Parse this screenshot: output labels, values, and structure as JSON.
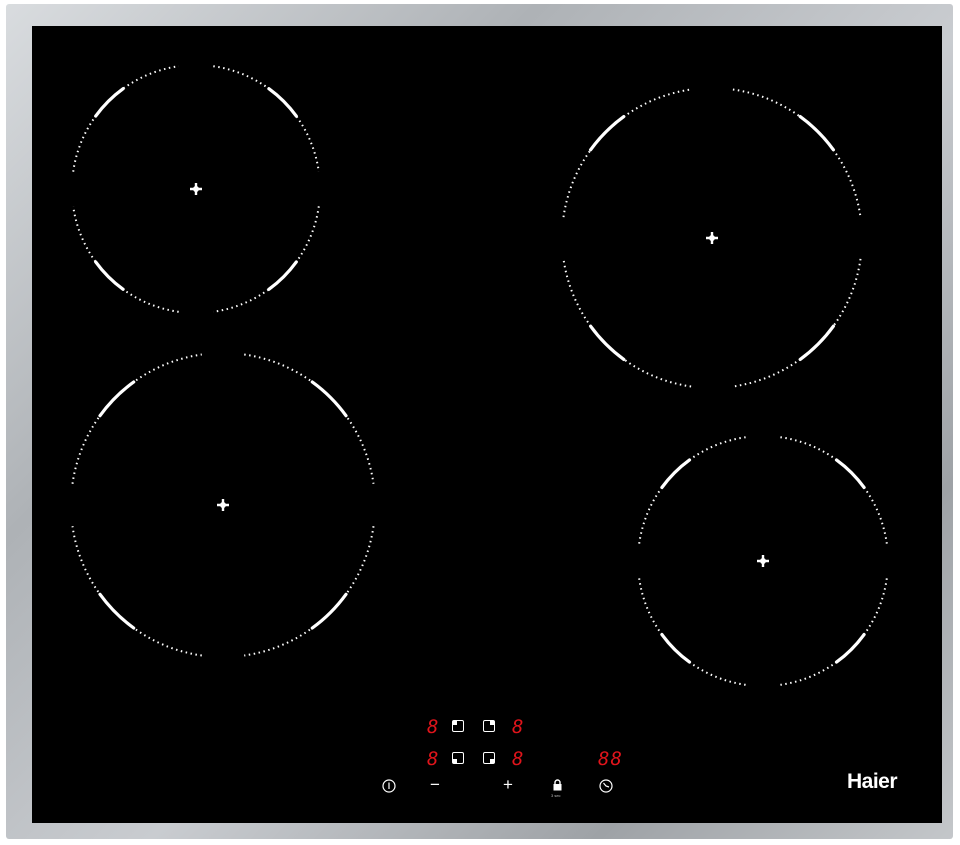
{
  "appliance": {
    "brand": "Haier",
    "accent_color": "#e0141b",
    "zones": [
      {
        "name": "rear-left",
        "indicator": "8"
      },
      {
        "name": "rear-right",
        "indicator": "8"
      },
      {
        "name": "front-left",
        "indicator": "8"
      },
      {
        "name": "front-right",
        "indicator": "8"
      }
    ],
    "timer_display": "88",
    "controls": {
      "power_icon": "power-icon",
      "minus_label": "−",
      "plus_label": "+",
      "lock_icon": "lock-icon",
      "lock_caption": "3 sec",
      "timer_icon": "timer-icon"
    }
  }
}
